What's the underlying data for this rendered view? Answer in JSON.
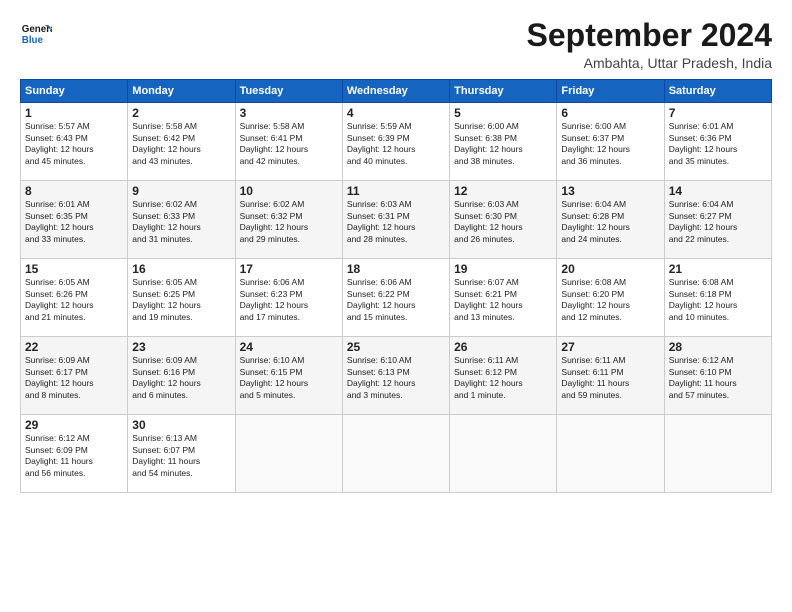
{
  "logo": {
    "line1": "General",
    "line2": "Blue"
  },
  "title": "September 2024",
  "location": "Ambahta, Uttar Pradesh, India",
  "weekdays": [
    "Sunday",
    "Monday",
    "Tuesday",
    "Wednesday",
    "Thursday",
    "Friday",
    "Saturday"
  ],
  "weeks": [
    [
      {
        "day": "1",
        "info": "Sunrise: 5:57 AM\nSunset: 6:43 PM\nDaylight: 12 hours\nand 45 minutes."
      },
      {
        "day": "2",
        "info": "Sunrise: 5:58 AM\nSunset: 6:42 PM\nDaylight: 12 hours\nand 43 minutes."
      },
      {
        "day": "3",
        "info": "Sunrise: 5:58 AM\nSunset: 6:41 PM\nDaylight: 12 hours\nand 42 minutes."
      },
      {
        "day": "4",
        "info": "Sunrise: 5:59 AM\nSunset: 6:39 PM\nDaylight: 12 hours\nand 40 minutes."
      },
      {
        "day": "5",
        "info": "Sunrise: 6:00 AM\nSunset: 6:38 PM\nDaylight: 12 hours\nand 38 minutes."
      },
      {
        "day": "6",
        "info": "Sunrise: 6:00 AM\nSunset: 6:37 PM\nDaylight: 12 hours\nand 36 minutes."
      },
      {
        "day": "7",
        "info": "Sunrise: 6:01 AM\nSunset: 6:36 PM\nDaylight: 12 hours\nand 35 minutes."
      }
    ],
    [
      {
        "day": "8",
        "info": "Sunrise: 6:01 AM\nSunset: 6:35 PM\nDaylight: 12 hours\nand 33 minutes."
      },
      {
        "day": "9",
        "info": "Sunrise: 6:02 AM\nSunset: 6:33 PM\nDaylight: 12 hours\nand 31 minutes."
      },
      {
        "day": "10",
        "info": "Sunrise: 6:02 AM\nSunset: 6:32 PM\nDaylight: 12 hours\nand 29 minutes."
      },
      {
        "day": "11",
        "info": "Sunrise: 6:03 AM\nSunset: 6:31 PM\nDaylight: 12 hours\nand 28 minutes."
      },
      {
        "day": "12",
        "info": "Sunrise: 6:03 AM\nSunset: 6:30 PM\nDaylight: 12 hours\nand 26 minutes."
      },
      {
        "day": "13",
        "info": "Sunrise: 6:04 AM\nSunset: 6:28 PM\nDaylight: 12 hours\nand 24 minutes."
      },
      {
        "day": "14",
        "info": "Sunrise: 6:04 AM\nSunset: 6:27 PM\nDaylight: 12 hours\nand 22 minutes."
      }
    ],
    [
      {
        "day": "15",
        "info": "Sunrise: 6:05 AM\nSunset: 6:26 PM\nDaylight: 12 hours\nand 21 minutes."
      },
      {
        "day": "16",
        "info": "Sunrise: 6:05 AM\nSunset: 6:25 PM\nDaylight: 12 hours\nand 19 minutes."
      },
      {
        "day": "17",
        "info": "Sunrise: 6:06 AM\nSunset: 6:23 PM\nDaylight: 12 hours\nand 17 minutes."
      },
      {
        "day": "18",
        "info": "Sunrise: 6:06 AM\nSunset: 6:22 PM\nDaylight: 12 hours\nand 15 minutes."
      },
      {
        "day": "19",
        "info": "Sunrise: 6:07 AM\nSunset: 6:21 PM\nDaylight: 12 hours\nand 13 minutes."
      },
      {
        "day": "20",
        "info": "Sunrise: 6:08 AM\nSunset: 6:20 PM\nDaylight: 12 hours\nand 12 minutes."
      },
      {
        "day": "21",
        "info": "Sunrise: 6:08 AM\nSunset: 6:18 PM\nDaylight: 12 hours\nand 10 minutes."
      }
    ],
    [
      {
        "day": "22",
        "info": "Sunrise: 6:09 AM\nSunset: 6:17 PM\nDaylight: 12 hours\nand 8 minutes."
      },
      {
        "day": "23",
        "info": "Sunrise: 6:09 AM\nSunset: 6:16 PM\nDaylight: 12 hours\nand 6 minutes."
      },
      {
        "day": "24",
        "info": "Sunrise: 6:10 AM\nSunset: 6:15 PM\nDaylight: 12 hours\nand 5 minutes."
      },
      {
        "day": "25",
        "info": "Sunrise: 6:10 AM\nSunset: 6:13 PM\nDaylight: 12 hours\nand 3 minutes."
      },
      {
        "day": "26",
        "info": "Sunrise: 6:11 AM\nSunset: 6:12 PM\nDaylight: 12 hours\nand 1 minute."
      },
      {
        "day": "27",
        "info": "Sunrise: 6:11 AM\nSunset: 6:11 PM\nDaylight: 11 hours\nand 59 minutes."
      },
      {
        "day": "28",
        "info": "Sunrise: 6:12 AM\nSunset: 6:10 PM\nDaylight: 11 hours\nand 57 minutes."
      }
    ],
    [
      {
        "day": "29",
        "info": "Sunrise: 6:12 AM\nSunset: 6:09 PM\nDaylight: 11 hours\nand 56 minutes."
      },
      {
        "day": "30",
        "info": "Sunrise: 6:13 AM\nSunset: 6:07 PM\nDaylight: 11 hours\nand 54 minutes."
      },
      {
        "day": "",
        "info": ""
      },
      {
        "day": "",
        "info": ""
      },
      {
        "day": "",
        "info": ""
      },
      {
        "day": "",
        "info": ""
      },
      {
        "day": "",
        "info": ""
      }
    ]
  ]
}
